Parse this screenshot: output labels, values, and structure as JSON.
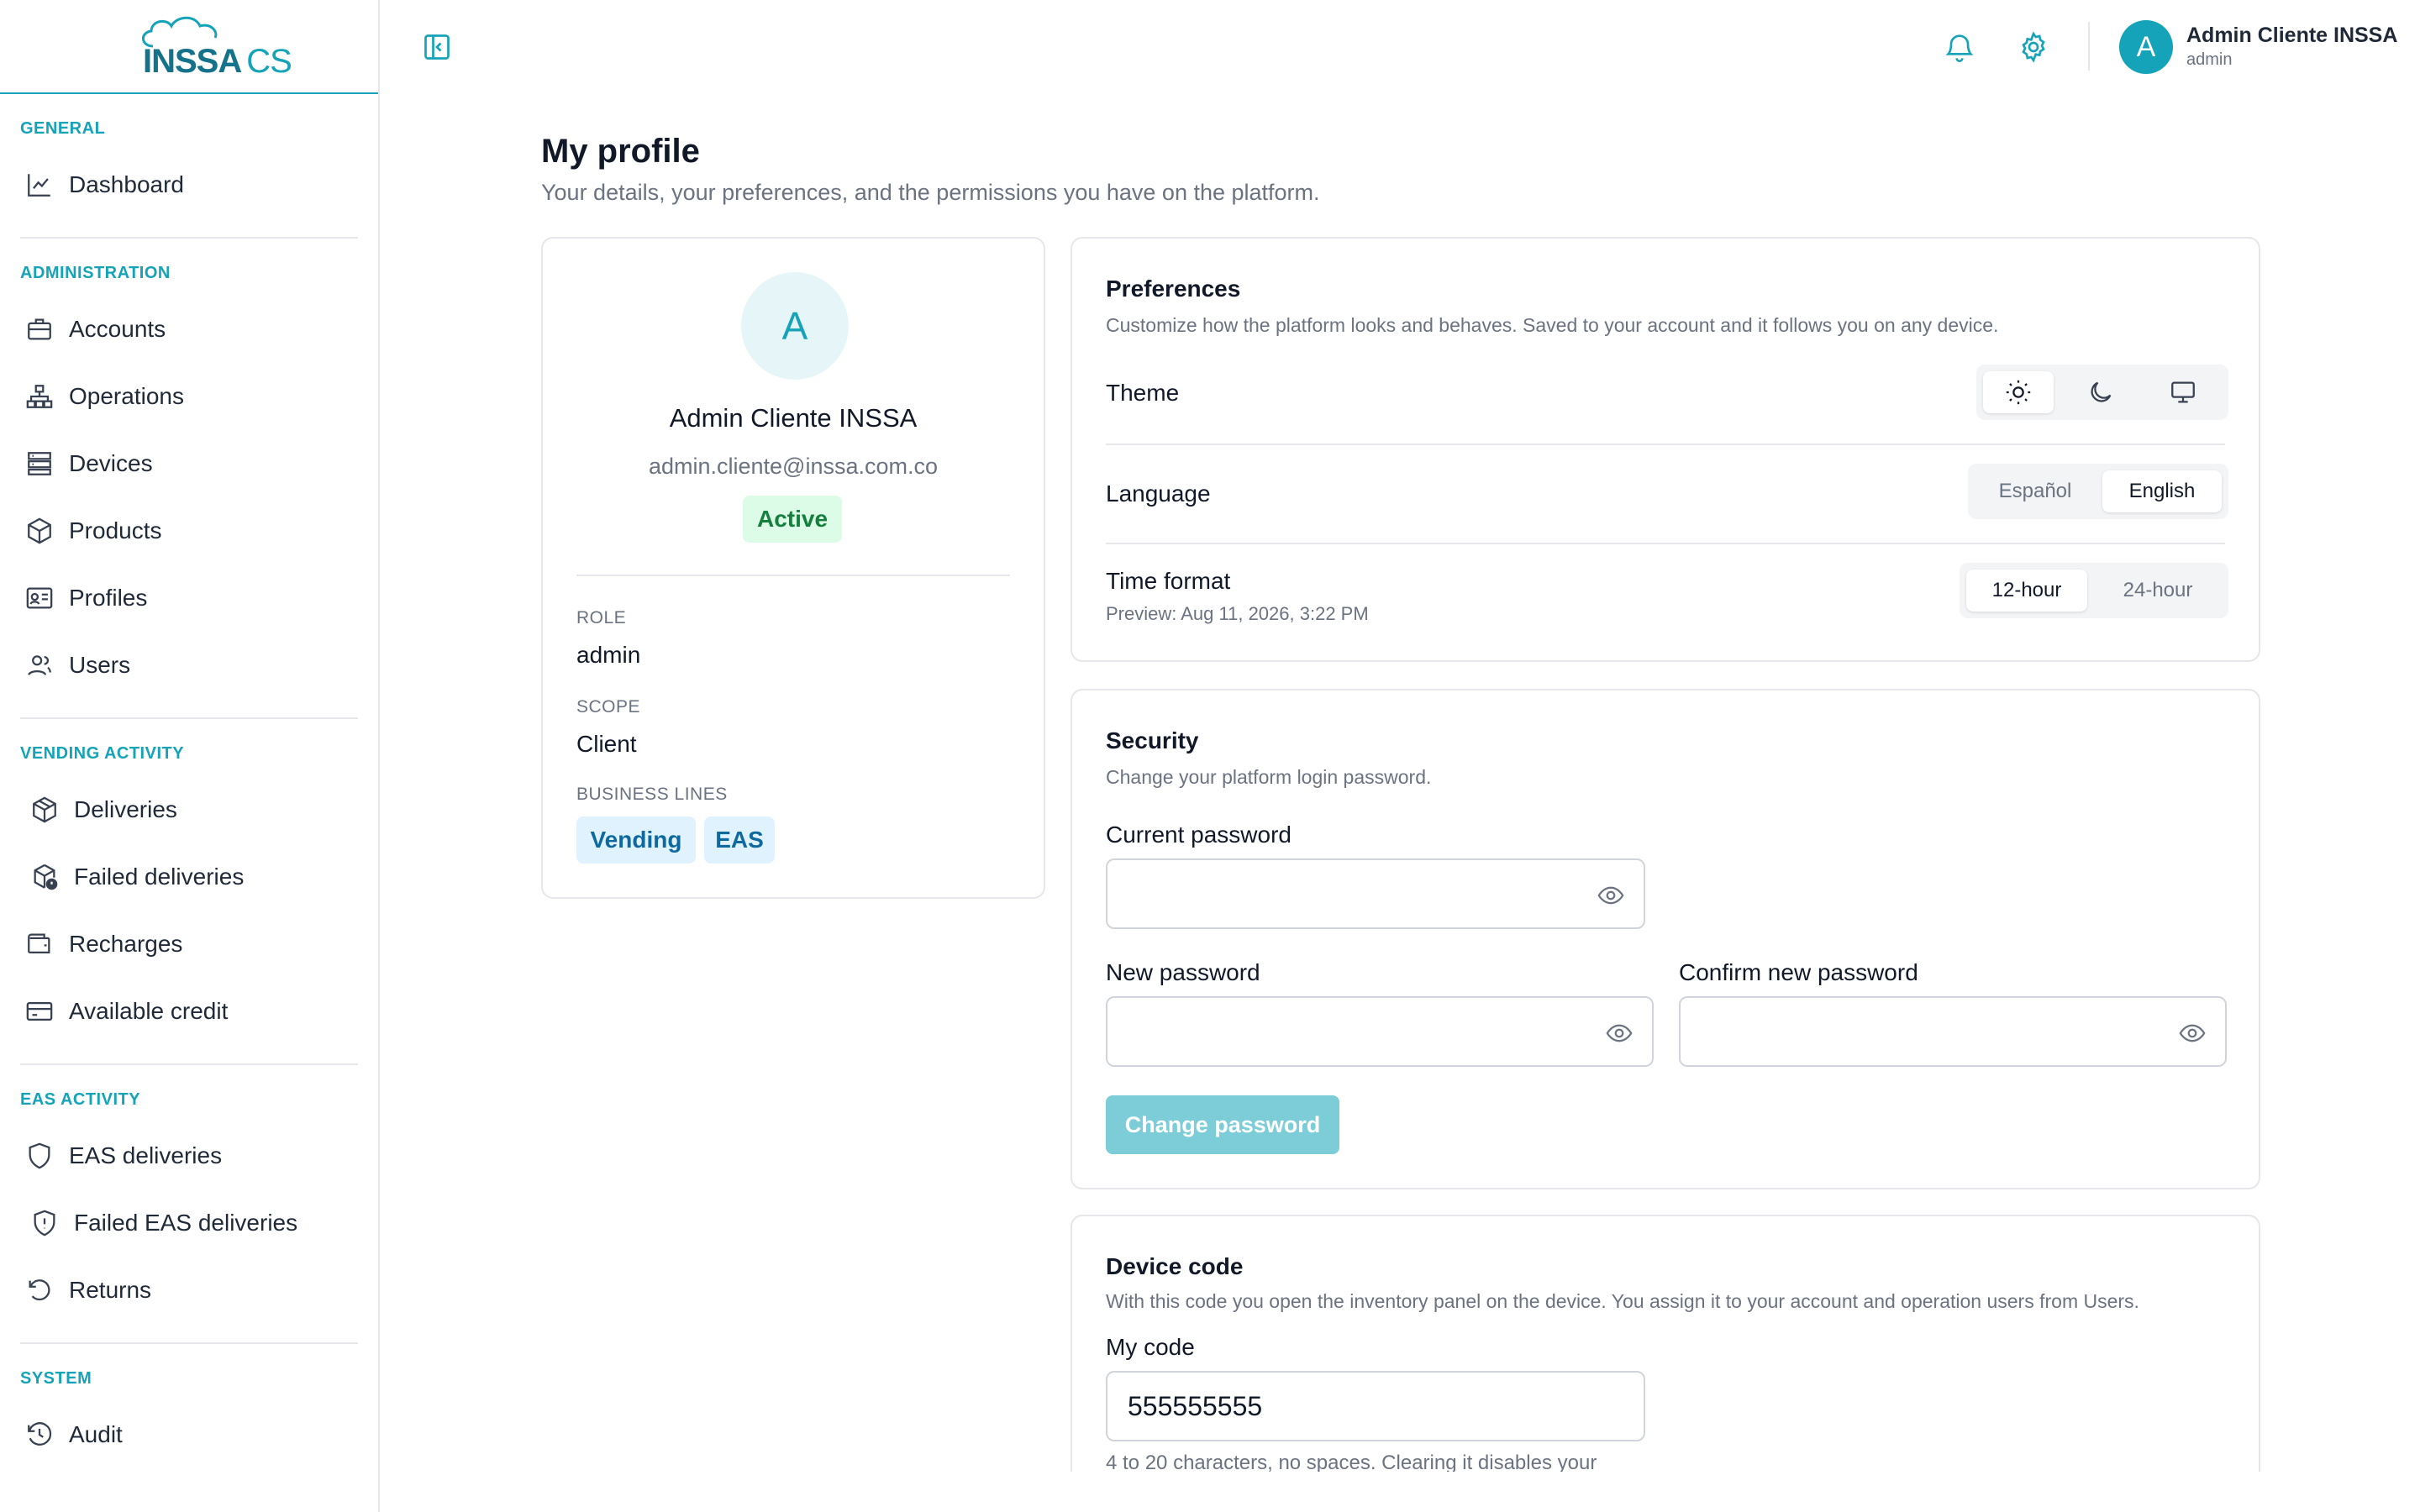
{
  "app": {
    "logo_text": "INSSA",
    "logo_cs": "CS"
  },
  "sidebar": {
    "sections": [
      {
        "title": "GENERAL",
        "items": [
          {
            "label": "Dashboard",
            "icon": "chart-line-icon"
          }
        ]
      },
      {
        "title": "ADMINISTRATION",
        "items": [
          {
            "label": "Accounts",
            "icon": "briefcase-icon"
          },
          {
            "label": "Operations",
            "icon": "org-chart-icon"
          },
          {
            "label": "Devices",
            "icon": "server-icon"
          },
          {
            "label": "Products",
            "icon": "box-icon"
          },
          {
            "label": "Profiles",
            "icon": "id-card-icon"
          },
          {
            "label": "Users",
            "icon": "users-icon"
          }
        ]
      },
      {
        "title": "VENDING ACTIVITY",
        "items": [
          {
            "label": "Deliveries",
            "icon": "package-icon"
          },
          {
            "label": "Failed deliveries",
            "icon": "package-alert-icon"
          },
          {
            "label": "Recharges",
            "icon": "wallet-icon"
          },
          {
            "label": "Available credit",
            "icon": "credit-card-icon"
          }
        ]
      },
      {
        "title": "EAS ACTIVITY",
        "items": [
          {
            "label": "EAS deliveries",
            "icon": "shield-icon"
          },
          {
            "label": "Failed EAS deliveries",
            "icon": "shield-alert-icon"
          },
          {
            "label": "Returns",
            "icon": "rotate-icon"
          }
        ]
      },
      {
        "title": "SYSTEM",
        "items": [
          {
            "label": "Audit",
            "icon": "history-icon"
          }
        ]
      }
    ]
  },
  "topbar": {
    "user_initial": "A",
    "user_name": "Admin Cliente INSSA",
    "user_role": "admin"
  },
  "page": {
    "title": "My profile",
    "subtitle": "Your details, your preferences, and the permissions you have on the platform."
  },
  "profile": {
    "initial": "A",
    "name": "Admin Cliente INSSA",
    "email": "admin.cliente@inssa.com.co",
    "status": "Active",
    "role_label": "ROLE",
    "role": "admin",
    "scope_label": "SCOPE",
    "scope": "Client",
    "business_label": "BUSINESS LINES",
    "business_lines": [
      "Vending",
      "EAS"
    ]
  },
  "preferences": {
    "title": "Preferences",
    "description": "Customize how the platform looks and behaves. Saved to your account and it follows you on any device.",
    "theme_label": "Theme",
    "theme_selected": "light",
    "language_label": "Language",
    "language_options": [
      "Español",
      "English"
    ],
    "language_selected": "English",
    "time_label": "Time format",
    "time_preview": "Preview: Aug 11, 2026, 3:22 PM",
    "time_options": [
      "12-hour",
      "24-hour"
    ],
    "time_selected": "12-hour"
  },
  "security": {
    "title": "Security",
    "description": "Change your platform login password.",
    "current_label": "Current password",
    "new_label": "New password",
    "confirm_label": "Confirm new password",
    "current_value": "",
    "new_value": "",
    "confirm_value": "",
    "button": "Change password"
  },
  "device_code": {
    "title": "Device code",
    "description": "With this code you open the inventory panel on the device. You assign it to your account and operation users from Users.",
    "field_label": "My code",
    "value": "555555555",
    "hint": "4 to 20 characters, no spaces. Clearing it disables your"
  },
  "colors": {
    "accent": "#14a3b8",
    "active_badge_bg": "#dcfce7",
    "active_badge_fg": "#15803d",
    "tag_bg": "#e0f2fe"
  }
}
